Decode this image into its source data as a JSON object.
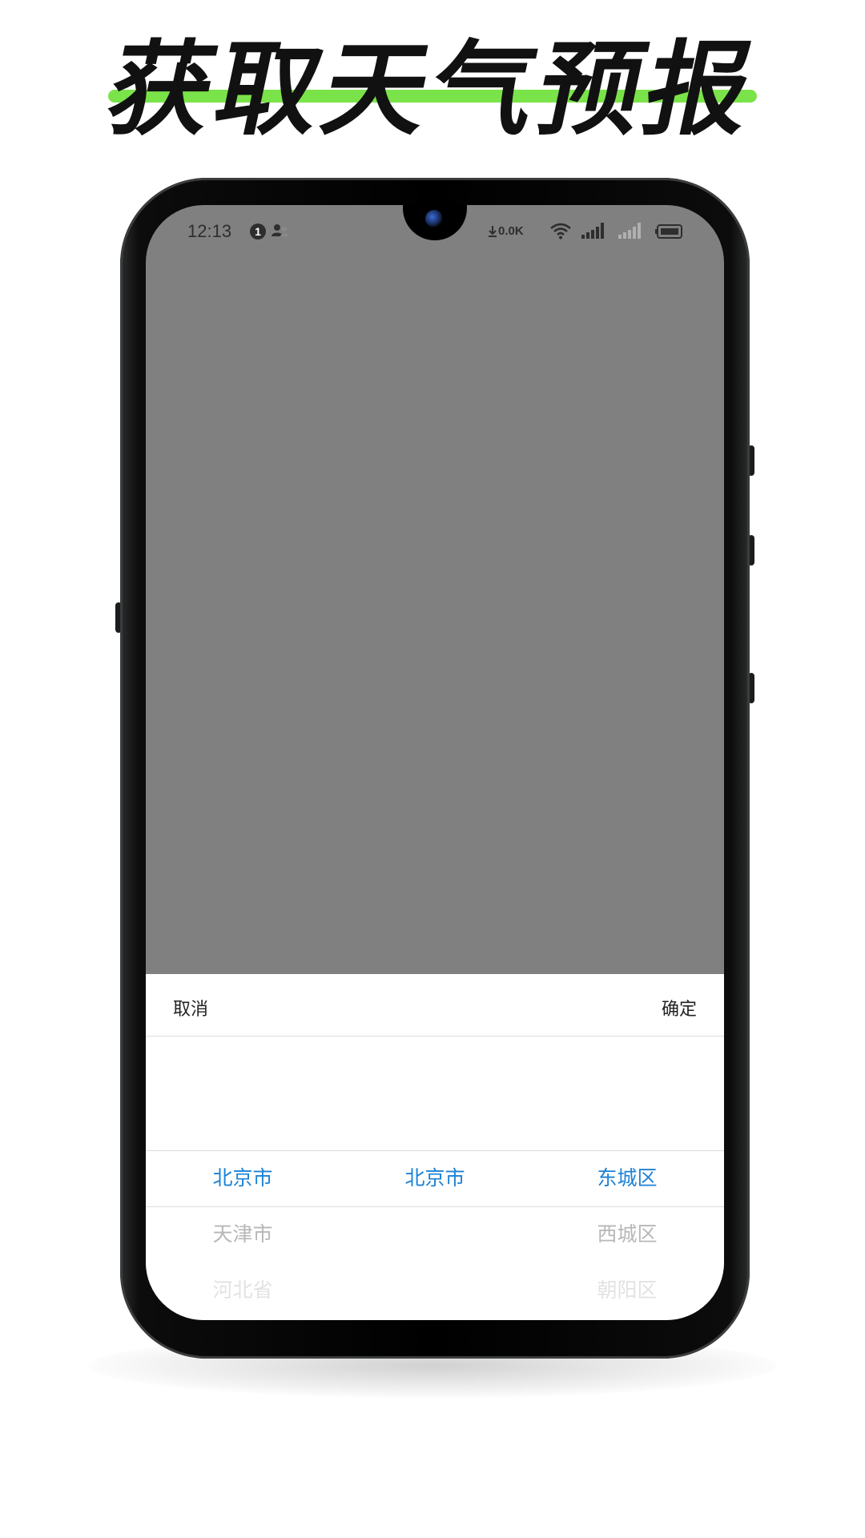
{
  "promo": {
    "headline": "获取天气预报",
    "accent_color": "#7be34a"
  },
  "status_bar": {
    "time": "12:13",
    "notification_count": "1",
    "net_speed": "0.0K",
    "icons": [
      "user-icon",
      "download-arrow-icon",
      "wifi-icon",
      "signal-icon",
      "signal-weak-icon",
      "battery-icon"
    ]
  },
  "picker_sheet": {
    "cancel_label": "取消",
    "confirm_label": "确定",
    "selected_color": "#1d82d6",
    "province_column": {
      "selected": "北京市",
      "next": "天津市",
      "after_next": "河北省"
    },
    "city_column": {
      "selected": "北京市"
    },
    "district_column": {
      "selected": "东城区",
      "next": "西城区",
      "after_next": "朝阳区"
    }
  }
}
